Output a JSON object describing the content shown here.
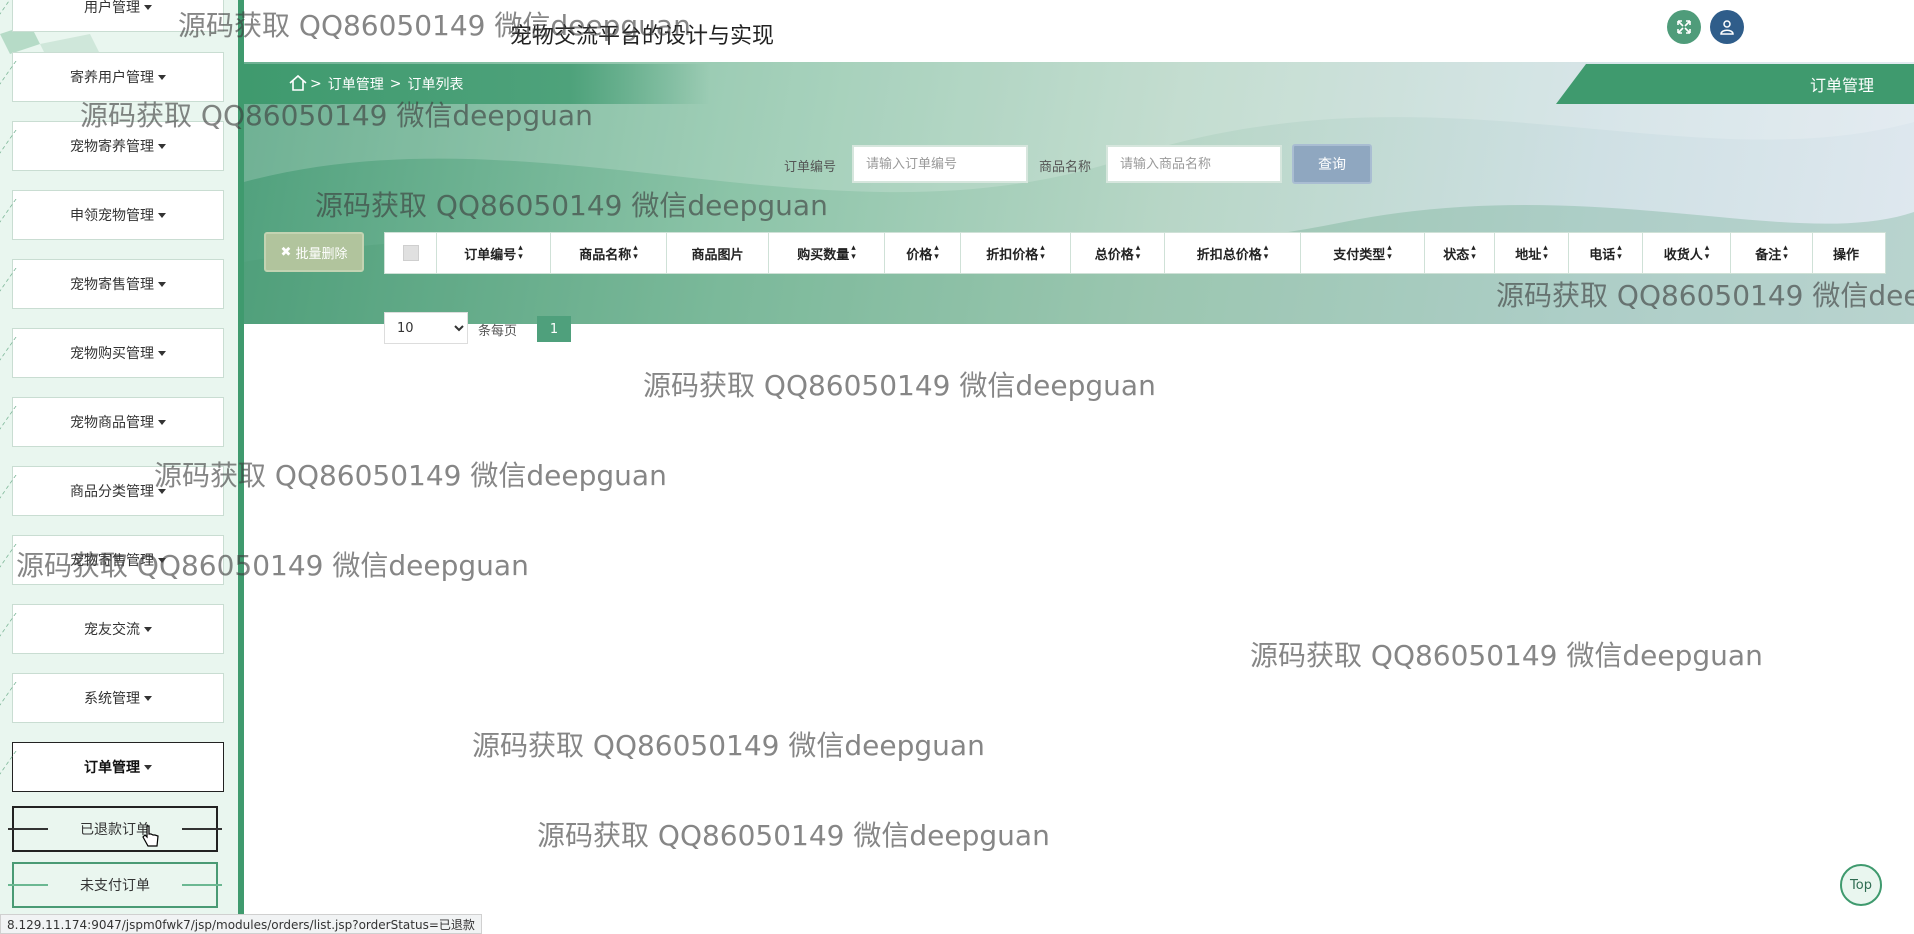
{
  "app": {
    "title": "宠物交流平台的设计与实现"
  },
  "sidebar": {
    "items": [
      {
        "label": "用户管理"
      },
      {
        "label": "寄养用户管理"
      },
      {
        "label": "宠物寄养管理"
      },
      {
        "label": "申领宠物管理"
      },
      {
        "label": "宠物寄售管理"
      },
      {
        "label": "宠物购买管理"
      },
      {
        "label": "宠物商品管理"
      },
      {
        "label": "商品分类管理"
      },
      {
        "label": "宠物寄售管理"
      },
      {
        "label": "宠友交流"
      },
      {
        "label": "系统管理"
      },
      {
        "label": "订单管理"
      }
    ],
    "sub_items": [
      {
        "label": "已退款订单"
      },
      {
        "label": "未支付订单"
      }
    ]
  },
  "breadcrumb": {
    "items": [
      "订单管理",
      "订单列表"
    ],
    "separator": ">"
  },
  "page_tag": "订单管理",
  "search": {
    "order_no_label": "订单编号",
    "order_no_placeholder": "请输入订单编号",
    "product_label": "商品名称",
    "product_placeholder": "请输入商品名称",
    "query_button": "查询"
  },
  "batch_delete": "批量删除",
  "table": {
    "columns": [
      "订单编号",
      "商品名称",
      "商品图片",
      "购买数量",
      "价格",
      "折扣价格",
      "总价格",
      "折扣总价格",
      "支付类型",
      "状态",
      "地址",
      "电话",
      "收货人",
      "备注",
      "操作"
    ]
  },
  "pager": {
    "page_size": "10",
    "per_page_label": "条每页",
    "current_page": "1"
  },
  "top_button": "Top",
  "status_url": "8.129.11.174:9047/jspm0fwk7/jsp/modules/orders/list.jsp?orderStatus=已退款",
  "watermark": "源码获取 QQ86050149 微信deepguan",
  "colors": {
    "accent": "#3f9a6e",
    "sidebar_bg": "#e9f6ef",
    "query_btn": "#8fa7c0"
  }
}
